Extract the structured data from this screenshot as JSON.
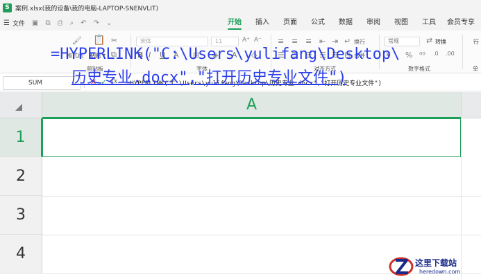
{
  "window": {
    "app_icon_letter": "S",
    "title": "案例.xlsx(我的设备\\我的电脑-LAPTOP-SNENVLIT)"
  },
  "menu": {
    "file_label": "文件",
    "tabs": [
      {
        "label": "开始",
        "active": true
      },
      {
        "label": "插入",
        "active": false
      },
      {
        "label": "页面",
        "active": false
      },
      {
        "label": "公式",
        "active": false
      },
      {
        "label": "数据",
        "active": false
      },
      {
        "label": "审阅",
        "active": false
      },
      {
        "label": "视图",
        "active": false
      },
      {
        "label": "工具",
        "active": false
      },
      {
        "label": "会员专享",
        "active": false
      }
    ]
  },
  "ribbon": {
    "format_painter": "格式刷",
    "paste": "粘贴",
    "clipboard_group": "剪贴板",
    "font_name": "宋体",
    "font_size": "11",
    "font_group": "字体",
    "wrap_text": "换行",
    "merge": "合并",
    "align_group": "对齐方式",
    "number_format": "常规",
    "convert": "转换",
    "number_group": "数字格式",
    "extra_group": "单",
    "extra_item": "行"
  },
  "formula_bar": {
    "name_box": "SUM",
    "fx": "fx",
    "formula": "=HYPERLINK(\"C:\\Users\\yulifang\\Desktop\\历史专业.docx\",\"打开历史专业文件\")"
  },
  "sheet": {
    "column_header": "A",
    "rows": [
      "1",
      "2",
      "3",
      "4"
    ],
    "cell_a1_line1": "=HYPERLINK(\"C:\\Users\\yulifang\\Desktop\\",
    "cell_a1_line2": "历史专业.docx\",\"打开历史专业文件\")"
  },
  "watermark": {
    "name": "这里下载站",
    "url": "heredown.com"
  },
  "colors": {
    "accent": "#1e9e5a",
    "link": "#2b3ee8"
  }
}
